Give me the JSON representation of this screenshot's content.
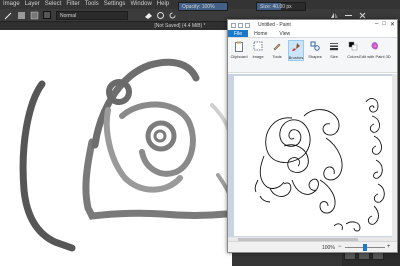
{
  "krita": {
    "menu": [
      "Image",
      "Layer",
      "Select",
      "Filter",
      "Tools",
      "Settings",
      "Window",
      "Help"
    ],
    "blend_mode": "Normal",
    "opacity_label": "Opacity: 100%",
    "opacity_value": 1.0,
    "size_label": "Size: 40.00 px",
    "size_value": 0.5,
    "document_title": "[Not Saved] (4.4 MiB) *",
    "foreground_color": "#555555",
    "background_color": "#ffffff"
  },
  "paint": {
    "window_title": "Untitled - Paint",
    "tabs": [
      "File",
      "Home",
      "View"
    ],
    "ribbon": [
      {
        "label": "Clipboard",
        "icon": "clipboard-icon"
      },
      {
        "label": "Image",
        "icon": "image-icon"
      },
      {
        "label": "Tools",
        "icon": "pencil-icon"
      },
      {
        "label": "Brushes",
        "icon": "brush-icon"
      },
      {
        "label": "Shapes",
        "icon": "shapes-icon"
      },
      {
        "label": "Size",
        "icon": "size-icon"
      },
      {
        "label": "Colors",
        "icon": "colors-icon"
      },
      {
        "label": "Edit with Paint 3D",
        "icon": "paint3d-icon"
      }
    ],
    "zoom": "100%",
    "zoom_minus": "−",
    "zoom_plus": "+",
    "zoom_level": 0.5,
    "accent": "#1979ca"
  }
}
